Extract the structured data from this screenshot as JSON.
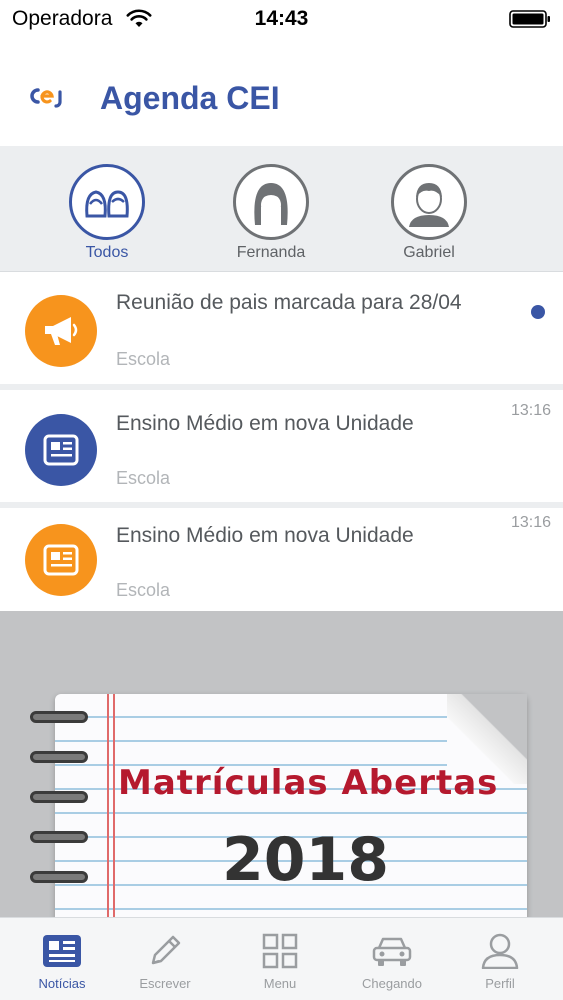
{
  "status_bar": {
    "carrier": "Operadora",
    "time": "14:43"
  },
  "header": {
    "title": "Agenda CEI",
    "logo_text": "CEI"
  },
  "filters": [
    {
      "label": "Todos",
      "active": true
    },
    {
      "label": "Fernanda",
      "active": false
    },
    {
      "label": "Gabriel",
      "active": false
    }
  ],
  "feed": [
    {
      "title": "Reunião de pais marcada para 28/04",
      "source": "Escola",
      "time": "",
      "icon": "megaphone-icon",
      "color": "#f7941d",
      "unread": true
    },
    {
      "title": "Ensino Médio em nova Unidade",
      "source": "Escola",
      "time": "13:16",
      "icon": "newspaper-icon",
      "color": "#3a56a5",
      "unread": false
    },
    {
      "title": "Ensino Médio em nova Unidade",
      "source": "Escola",
      "time": "13:16",
      "icon": "newspaper-icon",
      "color": "#f7941d",
      "unread": false
    }
  ],
  "banner": {
    "headline": "Matrículas Abertas",
    "year": "2018"
  },
  "tabs": [
    {
      "label": "Notícias",
      "icon": "news-icon",
      "active": true
    },
    {
      "label": "Escrever",
      "icon": "pencil-icon",
      "active": false
    },
    {
      "label": "Menu",
      "icon": "grid-icon",
      "active": false
    },
    {
      "label": "Chegando",
      "icon": "car-icon",
      "active": false
    },
    {
      "label": "Perfil",
      "icon": "person-icon",
      "active": false
    }
  ],
  "colors": {
    "brand": "#3a56a5",
    "accent": "#f7941d",
    "unread": "#3a56a5"
  }
}
